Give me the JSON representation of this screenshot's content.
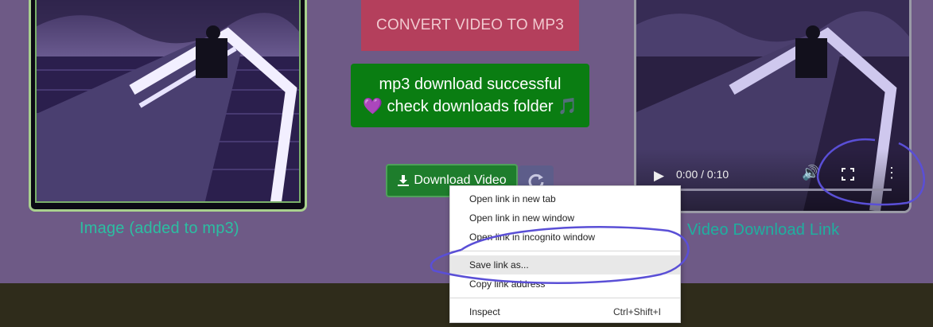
{
  "left_panel": {
    "caption": "Image (added to mp3)"
  },
  "convert_button": {
    "label": "CONVERT VIDEO TO MP3"
  },
  "success_message": {
    "line1": "mp3 download successful",
    "line2": "check downloads folder",
    "heart_glyph": "💜",
    "note_glyph": "🎵"
  },
  "download_button": {
    "label": "Download Video",
    "icon": "download-icon"
  },
  "refresh_button": {
    "icon": "refresh-icon"
  },
  "video_player": {
    "time": "0:00 / 0:10",
    "caption": "Video Download Link"
  },
  "context_menu": {
    "items": [
      {
        "label": "Open link in new tab"
      },
      {
        "label": "Open link in new window"
      },
      {
        "label": "Open link in incognito window"
      },
      {
        "label": "Save link as..."
      },
      {
        "label": "Copy link address"
      },
      {
        "label": "Inspect",
        "shortcut": "Ctrl+Shift+I"
      }
    ]
  },
  "colors": {
    "page_bg": "#6e5a86",
    "footer_bg": "#2f2c1b",
    "convert_bg": "#b43f5c",
    "success_bg": "#0a7d12",
    "annotation": "#5a4fd6"
  }
}
